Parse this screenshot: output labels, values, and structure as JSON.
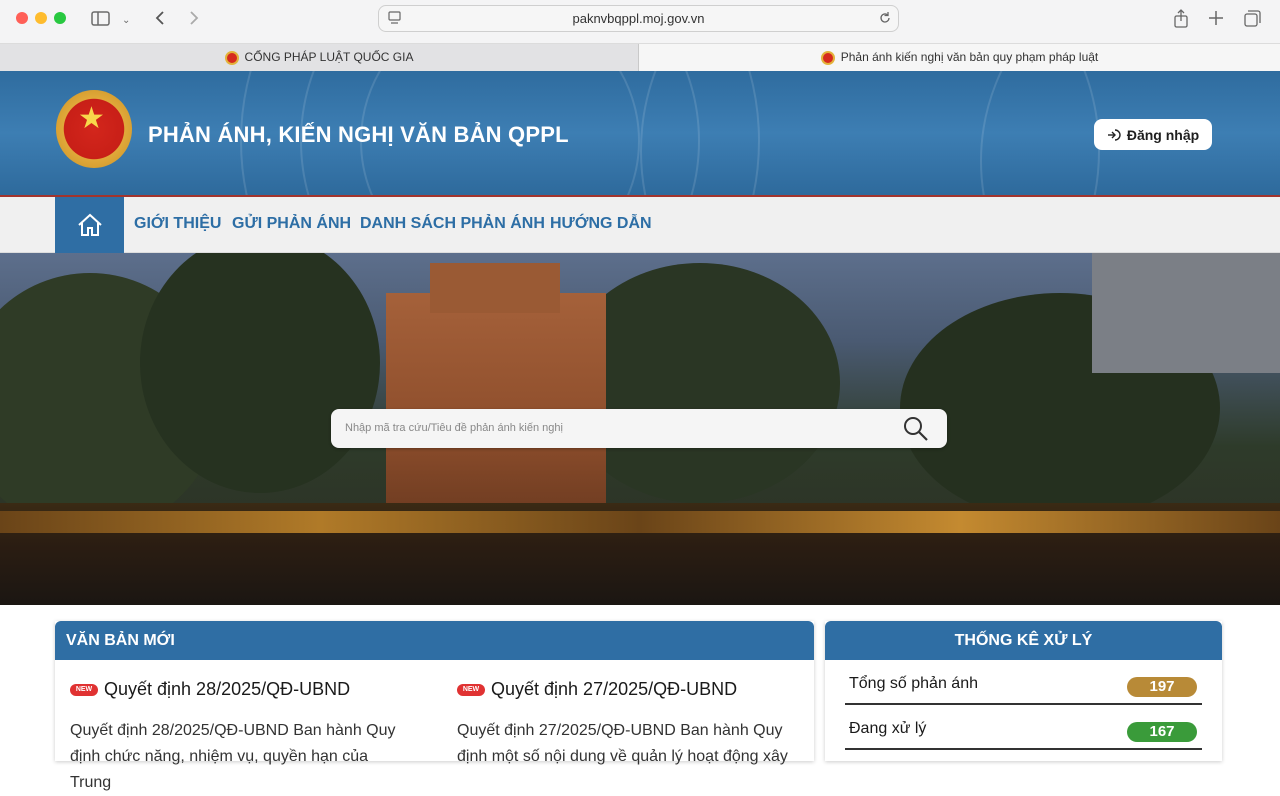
{
  "browser": {
    "url": "paknvbqppl.moj.gov.vn",
    "tabs": [
      {
        "label": "CỔNG PHÁP LUẬT QUỐC GIA"
      },
      {
        "label": "Phản ánh kiến nghị văn bản quy phạm pháp luật"
      }
    ]
  },
  "header": {
    "title": "PHẢN ÁNH, KIẾN NGHỊ VĂN BẢN QPPL",
    "login_label": "Đăng nhập"
  },
  "nav": {
    "items": [
      {
        "label": "GIỚI THIỆU"
      },
      {
        "label": "GỬI PHẢN ÁNH"
      },
      {
        "label": "DANH SÁCH PHẢN ÁNH"
      },
      {
        "label": "HƯỚNG DẪN"
      }
    ]
  },
  "search": {
    "placeholder": "Nhập mã tra cứu/Tiêu đề phản ánh kiến nghị"
  },
  "new_docs": {
    "heading": "VĂN BẢN MỚI",
    "badge": "NEW",
    "items": [
      {
        "title": "Quyết định 28/2025/QĐ-UBND",
        "desc": "Quyết định 28/2025/QĐ-UBND Ban hành Quy định chức năng, nhiệm vụ, quyền hạn của Trung"
      },
      {
        "title": "Quyết định 27/2025/QĐ-UBND",
        "desc": "Quyết định 27/2025/QĐ-UBND Ban hành Quy định một số nội dung về quản lý hoạt động xây"
      }
    ]
  },
  "stats": {
    "heading": "THỐNG KÊ XỬ LÝ",
    "items": [
      {
        "label": "Tổng số phản ánh",
        "value": "197",
        "color": "#b88a37"
      },
      {
        "label": "Đang xử lý",
        "value": "167",
        "color": "#3a9b3a"
      }
    ]
  },
  "colors": {
    "primary": "#2f6ea4",
    "header_border": "#a2342d"
  }
}
